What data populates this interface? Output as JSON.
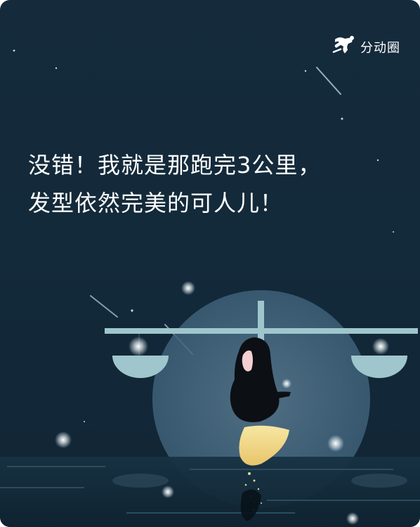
{
  "brand": {
    "name": "分动圈",
    "icon": "runner-icon"
  },
  "headline": {
    "line1": "没错！我就是那跑完3公里，",
    "line2": "发型依然完美的可人儿！"
  },
  "colors": {
    "background": "#132a3a",
    "moon": "#4b6f88",
    "scale": "#9fc6cc",
    "glow": "#f3e7a8",
    "text": "#ffffff"
  }
}
